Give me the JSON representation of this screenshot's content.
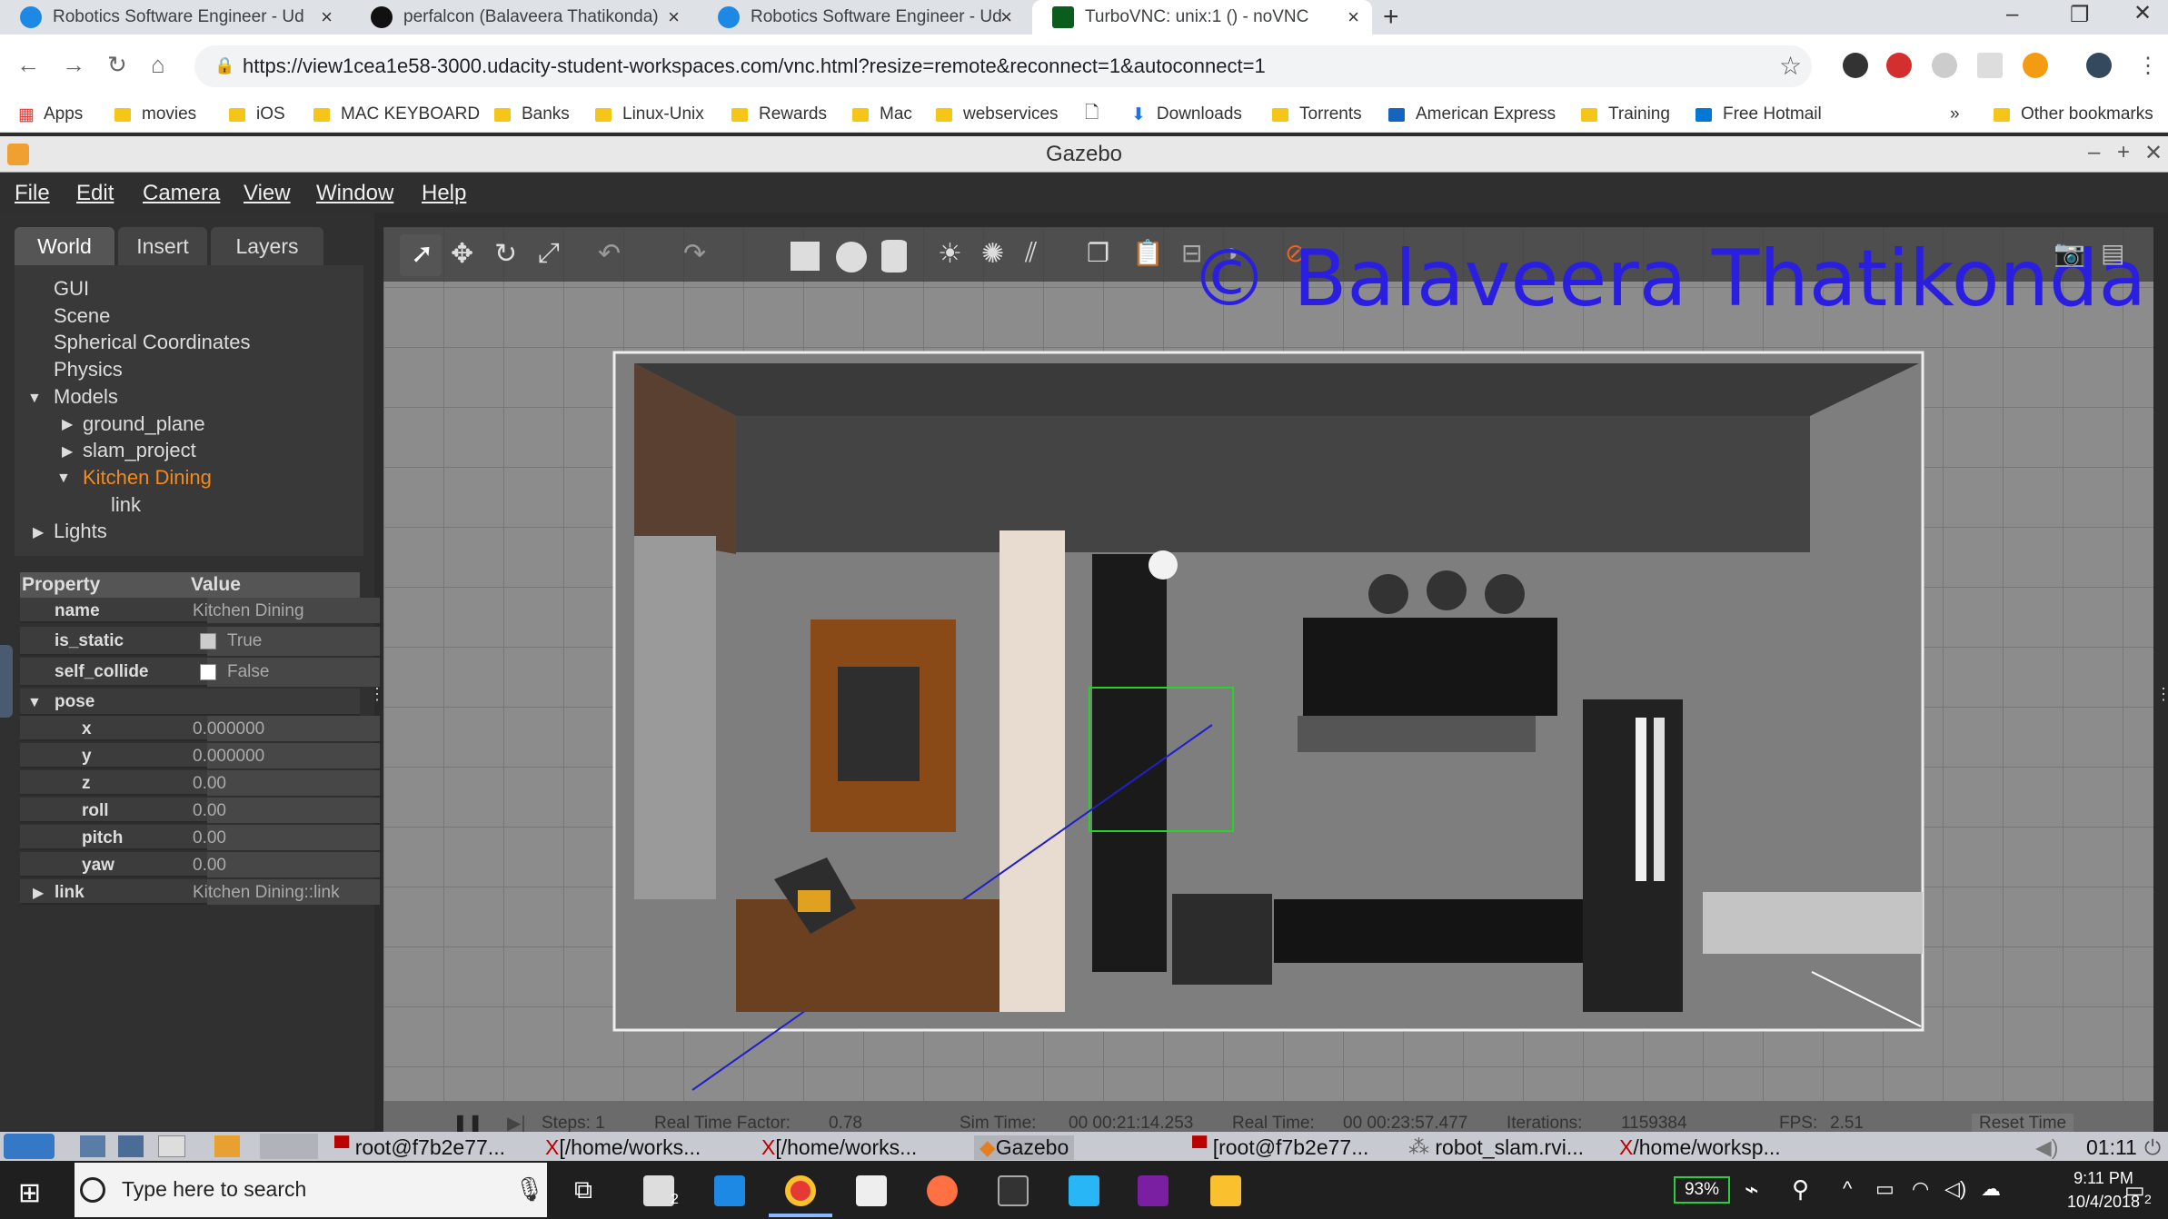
{
  "browser": {
    "tabs": [
      {
        "title": "Robotics Software Engineer - Ud",
        "icon": "udacity-icon",
        "color": "#1e88e5"
      },
      {
        "title": "perfalcon (Balaveera Thatikonda)",
        "icon": "github-icon",
        "color": "#111111"
      },
      {
        "title": "Robotics Software Engineer - Ud",
        "icon": "udacity-icon",
        "color": "#1e88e5"
      },
      {
        "title": "TurboVNC: unix:1 () - noVNC",
        "icon": "vnc-icon",
        "color": "#0b5d1e"
      }
    ],
    "new_tab": "+",
    "url": "https://view1cea1e58-3000.udacity-student-workspaces.com/vnc.html?resize=remote&reconnect=1&autoconnect=1",
    "bookmarks": [
      "Apps",
      "movies",
      "iOS",
      "MAC KEYBOARD",
      "Banks",
      "Linux-Unix",
      "Rewards",
      "Mac",
      "webservices",
      "Downloads",
      "Torrents",
      "American Express",
      "Training",
      "Free Hotmail",
      "»",
      "Other bookmarks"
    ]
  },
  "gazebo": {
    "title": "Gazebo",
    "menu": [
      "File",
      "Edit",
      "Camera",
      "View",
      "Window",
      "Help"
    ],
    "panel_tabs": [
      "World",
      "Insert",
      "Layers"
    ],
    "tree": {
      "gui": "GUI",
      "scene": "Scene",
      "spherical": "Spherical Coordinates",
      "physics": "Physics",
      "models": "Models",
      "ground_plane": "ground_plane",
      "slam_project": "slam_project",
      "kitchen": "Kitchen Dining",
      "link": "link",
      "lights": "Lights"
    },
    "properties": {
      "header_property": "Property",
      "header_value": "Value",
      "rows": [
        {
          "key": "name",
          "value": "Kitchen Dining"
        },
        {
          "key": "is_static",
          "value": "True"
        },
        {
          "key": "self_collide",
          "value": "False"
        },
        {
          "key": "pose",
          "value": ""
        },
        {
          "key": "x",
          "value": "0.000000"
        },
        {
          "key": "y",
          "value": "0.000000"
        },
        {
          "key": "z",
          "value": "0.00"
        },
        {
          "key": "roll",
          "value": "0.00"
        },
        {
          "key": "pitch",
          "value": "0.00"
        },
        {
          "key": "yaw",
          "value": "0.00"
        },
        {
          "key": "link",
          "value": "Kitchen Dining::link"
        }
      ]
    },
    "watermark": "© Balaveera Thatikonda",
    "status": {
      "steps": "Steps: 1",
      "rtf": "Real Time Factor:",
      "rtf_val": "0.78",
      "sim": "Sim Time:",
      "sim_val": "00 00:21:14.253",
      "real": "Real Time:",
      "real_val": "00 00:23:57.477",
      "iter": "Iterations:",
      "iter_val": "1159384",
      "fps": "FPS:",
      "fps_val": "2.51",
      "reset": "Reset Time"
    }
  },
  "vnc_taskbar": {
    "items": [
      "root@f7b2e77...",
      "[/home/works...",
      "[/home/works...",
      "Gazebo",
      "[root@f7b2e77...",
      "robot_slam.rvi...",
      "/home/worksp..."
    ],
    "time": "01:11"
  },
  "windows": {
    "search_placeholder": "Type here to search",
    "battery": "93%",
    "time": "9:11 PM",
    "date": "10/4/2018",
    "notif_count": "2",
    "mail_count": "2"
  }
}
